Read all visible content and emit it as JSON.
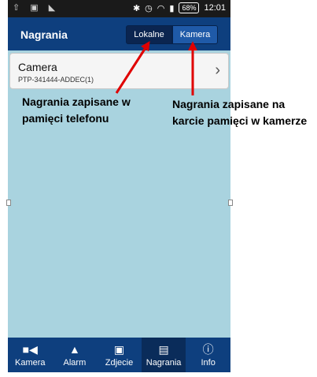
{
  "status_bar": {
    "battery": "68%",
    "time": "12:01"
  },
  "app_bar": {
    "title": "Nagrania",
    "segments": {
      "local": "Lokalne",
      "camera": "Kamera"
    }
  },
  "device_list": [
    {
      "name": "Camera",
      "id": "PTP-341444-ADDEC(1)"
    }
  ],
  "bottom_nav": {
    "items": [
      {
        "label": "Kamera",
        "icon": "video-camera-icon"
      },
      {
        "label": "Alarm",
        "icon": "alarm-bell-icon"
      },
      {
        "label": "Zdjecie",
        "icon": "photo-icon"
      },
      {
        "label": "Nagrania",
        "icon": "film-icon"
      },
      {
        "label": "Info",
        "icon": "info-icon"
      }
    ]
  },
  "annotations": {
    "local_note": "Nagrania zapisane w pamięci telefonu",
    "camera_note": "Nagrania zapisane na karcie pamięci w kamerze"
  },
  "colors": {
    "app_bar": "#0e3f7e",
    "background": "#a9d3df",
    "arrow": "#e00000"
  }
}
